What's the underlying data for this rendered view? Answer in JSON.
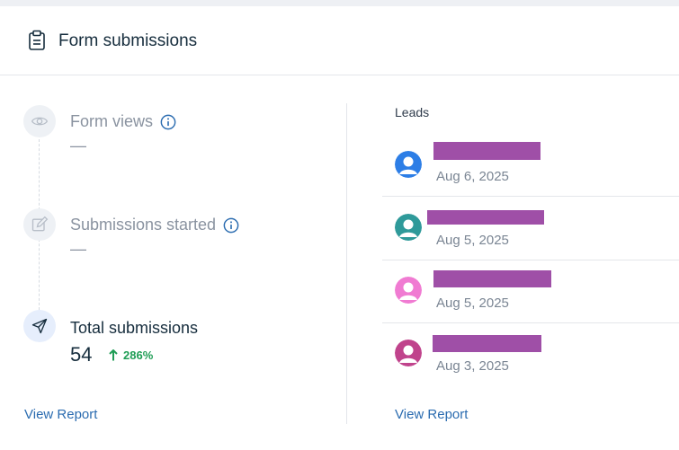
{
  "header": {
    "title": "Form submissions",
    "icon": "clipboard-icon"
  },
  "funnel": {
    "steps": [
      {
        "label": "Form views",
        "value": "—",
        "icon": "eye-icon",
        "state": "muted",
        "has_info": true
      },
      {
        "label": "Submissions started",
        "value": "—",
        "icon": "pencil-square-icon",
        "state": "muted",
        "has_info": true
      },
      {
        "label": "Total submissions",
        "value": "54",
        "icon": "send-icon",
        "state": "active",
        "has_info": false
      }
    ],
    "trend": {
      "value": "286%",
      "direction": "up",
      "color": "#1f9d55"
    },
    "view_report": "View Report"
  },
  "leads": {
    "title": "Leads",
    "items": [
      {
        "date": "Aug 6, 2025",
        "avatar_color": "#2d7ee6"
      },
      {
        "date": "Aug 5, 2025",
        "avatar_color": "#2f9a9a"
      },
      {
        "date": "Aug 5, 2025",
        "avatar_color": "#f07bd2"
      },
      {
        "date": "Aug 3, 2025",
        "avatar_color": "#c0438c"
      }
    ],
    "view_report": "View Report"
  },
  "colors": {
    "accent": "#2b6cb0",
    "redaction": "#9f4fa7"
  }
}
